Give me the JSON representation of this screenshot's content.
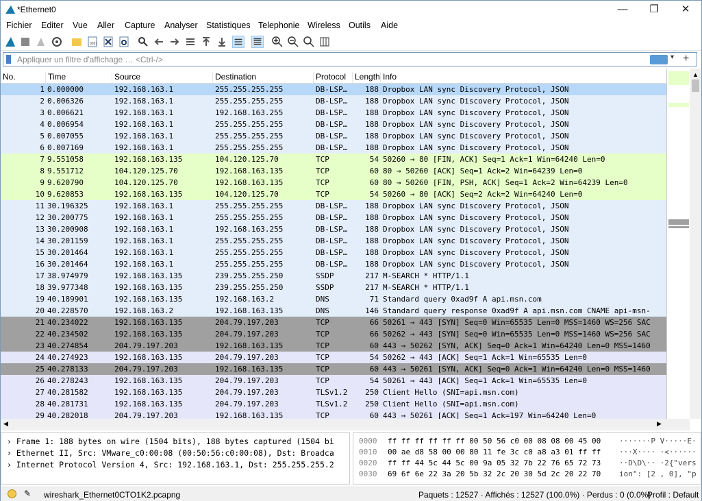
{
  "window": {
    "title": "*Ethernet0",
    "minimize": "—",
    "maximize": "❐",
    "close": "✕"
  },
  "menu": [
    "Fichier",
    "Editer",
    "Vue",
    "Aller",
    "Capture",
    "Analyser",
    "Statistiques",
    "Telephonie",
    "Wireless",
    "Outils",
    "Aide"
  ],
  "filter": {
    "placeholder": "Appliquer un filtre d'affichage … <Ctrl-/>",
    "dropdown": "▾",
    "add": "+"
  },
  "columns": [
    "No.",
    "Time",
    "Source",
    "Destination",
    "Protocol",
    "Length",
    "Info"
  ],
  "colors": {
    "dbl": "#e4eefa",
    "tcp": "#e6ffc8",
    "gray": "#a0a0a0",
    "lav": "#e6e6fa",
    "sel": "#b7d8f8"
  },
  "packets": [
    [
      "1",
      "0.000000",
      "192.168.163.1",
      "255.255.255.255",
      "DB-LSP…",
      "188",
      "Dropbox LAN sync Discovery Protocol, JSON",
      "sel"
    ],
    [
      "2",
      "0.006326",
      "192.168.163.1",
      "255.255.255.255",
      "DB-LSP…",
      "188",
      "Dropbox LAN sync Discovery Protocol, JSON",
      "dbl"
    ],
    [
      "3",
      "0.006621",
      "192.168.163.1",
      "192.168.163.255",
      "DB-LSP…",
      "188",
      "Dropbox LAN sync Discovery Protocol, JSON",
      "dbl"
    ],
    [
      "4",
      "0.006954",
      "192.168.163.1",
      "255.255.255.255",
      "DB-LSP…",
      "188",
      "Dropbox LAN sync Discovery Protocol, JSON",
      "dbl"
    ],
    [
      "5",
      "0.007055",
      "192.168.163.1",
      "255.255.255.255",
      "DB-LSP…",
      "188",
      "Dropbox LAN sync Discovery Protocol, JSON",
      "dbl"
    ],
    [
      "6",
      "0.007169",
      "192.168.163.1",
      "255.255.255.255",
      "DB-LSP…",
      "188",
      "Dropbox LAN sync Discovery Protocol, JSON",
      "dbl"
    ],
    [
      "7",
      "9.551058",
      "192.168.163.135",
      "104.120.125.70",
      "TCP",
      "54",
      "50260 → 80 [FIN, ACK] Seq=1 Ack=1 Win=64240 Len=0",
      "tcp"
    ],
    [
      "8",
      "9.551712",
      "104.120.125.70",
      "192.168.163.135",
      "TCP",
      "60",
      "80 → 50260 [ACK] Seq=1 Ack=2 Win=64239 Len=0",
      "tcp"
    ],
    [
      "9",
      "9.620790",
      "104.120.125.70",
      "192.168.163.135",
      "TCP",
      "60",
      "80 → 50260 [FIN, PSH, ACK] Seq=1 Ack=2 Win=64239 Len=0",
      "tcp"
    ],
    [
      "10",
      "9.620853",
      "192.168.163.135",
      "104.120.125.70",
      "TCP",
      "54",
      "50260 → 80 [ACK] Seq=2 Ack=2 Win=64240 Len=0",
      "tcp"
    ],
    [
      "11",
      "30.196325",
      "192.168.163.1",
      "255.255.255.255",
      "DB-LSP…",
      "188",
      "Dropbox LAN sync Discovery Protocol, JSON",
      "dbl"
    ],
    [
      "12",
      "30.200775",
      "192.168.163.1",
      "255.255.255.255",
      "DB-LSP…",
      "188",
      "Dropbox LAN sync Discovery Protocol, JSON",
      "dbl"
    ],
    [
      "13",
      "30.200908",
      "192.168.163.1",
      "192.168.163.255",
      "DB-LSP…",
      "188",
      "Dropbox LAN sync Discovery Protocol, JSON",
      "dbl"
    ],
    [
      "14",
      "30.201159",
      "192.168.163.1",
      "255.255.255.255",
      "DB-LSP…",
      "188",
      "Dropbox LAN sync Discovery Protocol, JSON",
      "dbl"
    ],
    [
      "15",
      "30.201464",
      "192.168.163.1",
      "255.255.255.255",
      "DB-LSP…",
      "188",
      "Dropbox LAN sync Discovery Protocol, JSON",
      "dbl"
    ],
    [
      "16",
      "30.201464",
      "192.168.163.1",
      "255.255.255.255",
      "DB-LSP…",
      "188",
      "Dropbox LAN sync Discovery Protocol, JSON",
      "dbl"
    ],
    [
      "17",
      "38.974979",
      "192.168.163.135",
      "239.255.255.250",
      "SSDP",
      "217",
      "M-SEARCH * HTTP/1.1",
      "dbl"
    ],
    [
      "18",
      "39.977348",
      "192.168.163.135",
      "239.255.255.250",
      "SSDP",
      "217",
      "M-SEARCH * HTTP/1.1",
      "dbl"
    ],
    [
      "19",
      "40.189901",
      "192.168.163.135",
      "192.168.163.2",
      "DNS",
      "71",
      "Standard query 0xad9f A api.msn.com",
      "dbl"
    ],
    [
      "20",
      "40.228570",
      "192.168.163.2",
      "192.168.163.135",
      "DNS",
      "146",
      "Standard query response 0xad9f A api.msn.com CNAME api-msn-",
      "dbl"
    ],
    [
      "21",
      "40.234022",
      "192.168.163.135",
      "204.79.197.203",
      "TCP",
      "66",
      "50261 → 443 [SYN] Seq=0 Win=65535 Len=0 MSS=1460 WS=256 SAC",
      "gray"
    ],
    [
      "22",
      "40.234502",
      "192.168.163.135",
      "204.79.197.203",
      "TCP",
      "66",
      "50262 → 443 [SYN] Seq=0 Win=65535 Len=0 MSS=1460 WS=256 SAC",
      "gray"
    ],
    [
      "23",
      "40.274854",
      "204.79.197.203",
      "192.168.163.135",
      "TCP",
      "60",
      "443 → 50262 [SYN, ACK] Seq=0 Ack=1 Win=64240 Len=0 MSS=1460",
      "gray"
    ],
    [
      "24",
      "40.274923",
      "192.168.163.135",
      "204.79.197.203",
      "TCP",
      "54",
      "50262 → 443 [ACK] Seq=1 Ack=1 Win=65535 Len=0",
      "lav"
    ],
    [
      "25",
      "40.278133",
      "204.79.197.203",
      "192.168.163.135",
      "TCP",
      "60",
      "443 → 50261 [SYN, ACK] Seq=0 Ack=1 Win=64240 Len=0 MSS=1460",
      "gray"
    ],
    [
      "26",
      "40.278243",
      "192.168.163.135",
      "204.79.197.203",
      "TCP",
      "54",
      "50261 → 443 [ACK] Seq=1 Ack=1 Win=65535 Len=0",
      "lav"
    ],
    [
      "27",
      "40.281582",
      "192.168.163.135",
      "204.79.197.203",
      "TLSv1.2",
      "250",
      "Client Hello (SNI=api.msn.com)",
      "lav"
    ],
    [
      "28",
      "40.281731",
      "192.168.163.135",
      "204.79.197.203",
      "TLSv1.2",
      "250",
      "Client Hello (SNI=api.msn.com)",
      "lav"
    ],
    [
      "29",
      "40.282018",
      "204.79.197.203",
      "192.168.163.135",
      "TCP",
      "60",
      "443 → 50261 [ACK] Seq=1 Ack=197 Win=64240 Len=0",
      "lav"
    ]
  ],
  "details": [
    "Frame 1: 188 bytes on wire (1504 bits), 188 bytes captured (1504 bi",
    "Ethernet II, Src: VMware_c0:00:08 (00:50:56:c0:00:08), Dst: Broadca",
    "Internet Protocol Version 4, Src: 192.168.163.1, Dst: 255.255.255.2"
  ],
  "hex": [
    {
      "off": "0000",
      "bytes": "ff ff ff ff ff ff 00 50  56 c0 00 08 08 00 45 00",
      "ascii": "·······P V·····E·"
    },
    {
      "off": "0010",
      "bytes": "00 ae d8 58 00 00 80 11  fe 3c c0 a8 a3 01 ff ff",
      "ascii": "···X···· ·<······"
    },
    {
      "off": "0020",
      "bytes": "ff ff 44 5c 44 5c 00 9a  05 32 7b 22 76 65 72 73",
      "ascii": "··D\\D\\·· ·2{\"vers"
    },
    {
      "off": "0030",
      "bytes": "69 6f 6e 22 3a 20 5b 32  2c 20 30 5d 2c 20 22 70",
      "ascii": "ion\": [2 , 0], \"p"
    }
  ],
  "status": {
    "file": "wireshark_Ethernet0CTO1K2.pcapng",
    "stats": "Paquets : 12527 · Affichés : 12527 (100.0%) · Perdus : 0 (0.0%)",
    "profile": "Profil : Default"
  }
}
